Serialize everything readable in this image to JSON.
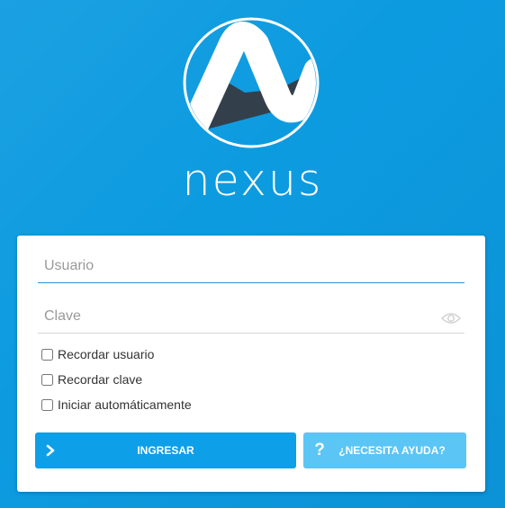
{
  "brand": {
    "name": "nexus"
  },
  "form": {
    "username": {
      "placeholder": "Usuario",
      "value": ""
    },
    "password": {
      "placeholder": "Clave",
      "value": ""
    },
    "options": [
      {
        "label": "Recordar usuario",
        "checked": false
      },
      {
        "label": "Recordar clave",
        "checked": false
      },
      {
        "label": "Iniciar automáticamente",
        "checked": false
      }
    ],
    "login_button": "INGRESAR",
    "help_button": "¿NECESITA AYUDA?"
  },
  "icons": {
    "logo": "nexus-logo-icon",
    "password_visibility": "eye-icon",
    "login_button_icon": "chevron-right-icon",
    "help_button_icon": "question-mark-icon"
  },
  "colors": {
    "background": "#0d9be0",
    "primary_button": "#0e9fe9",
    "secondary_button": "#5bc5f5",
    "logo_dark": "#33404c",
    "active_underline": "#2f8fd3"
  }
}
